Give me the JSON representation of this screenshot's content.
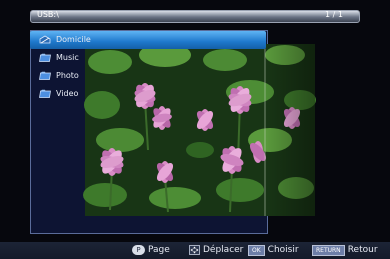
{
  "header": {
    "path": "USB:\\",
    "page_count": "1 / 1"
  },
  "folders": [
    {
      "label": "Domicile",
      "icon": "home-folder-icon",
      "selected": true
    },
    {
      "label": "Music",
      "icon": "folder-icon"
    },
    {
      "label": "Photo",
      "icon": "folder-icon"
    },
    {
      "label": "Video",
      "icon": "folder-icon"
    }
  ],
  "footer": {
    "page_key": "P",
    "page_label": "Page",
    "move_label": "Déplacer",
    "ok_key": "OK",
    "ok_label": "Choisir",
    "return_key": "RETURN",
    "return_label": "Retour"
  },
  "colors": {
    "selection": "#1e78cc",
    "panel_bg": "#0d1433",
    "leaf_green": "#3f7e2c",
    "flower_pink": "#d98cc6"
  }
}
